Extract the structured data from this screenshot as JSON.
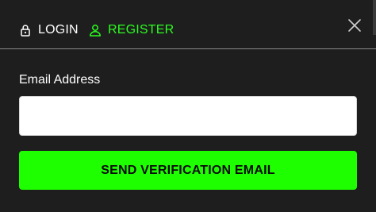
{
  "tabs": {
    "login": {
      "label": "LOGIN",
      "icon": "lock-icon"
    },
    "register": {
      "label": "REGISTER",
      "icon": "user-icon",
      "active": true
    }
  },
  "close": {
    "icon": "close-icon"
  },
  "form": {
    "email_label": "Email Address",
    "email_value": "",
    "submit_label": "SEND VERIFICATION EMAIL"
  },
  "colors": {
    "background": "#1e1e1e",
    "accent": "#1eff00",
    "active_tab_text": "#2aff1f",
    "text": "#ffffff"
  }
}
